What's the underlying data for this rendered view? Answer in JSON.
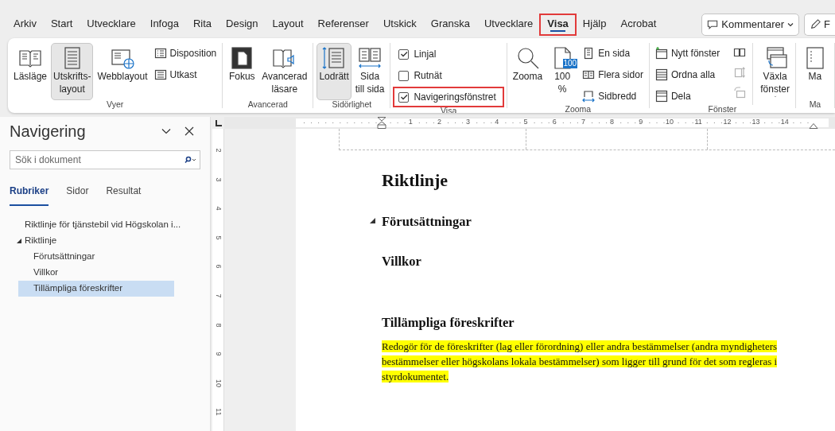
{
  "menu_tabs": [
    {
      "label": "Arkiv",
      "selected": false,
      "highlighted": false
    },
    {
      "label": "Start",
      "selected": false,
      "highlighted": false
    },
    {
      "label": "Utvecklare",
      "selected": false,
      "highlighted": false
    },
    {
      "label": "Infoga",
      "selected": false,
      "highlighted": false
    },
    {
      "label": "Rita",
      "selected": false,
      "highlighted": false
    },
    {
      "label": "Design",
      "selected": false,
      "highlighted": false
    },
    {
      "label": "Layout",
      "selected": false,
      "highlighted": false
    },
    {
      "label": "Referenser",
      "selected": false,
      "highlighted": false
    },
    {
      "label": "Utskick",
      "selected": false,
      "highlighted": false
    },
    {
      "label": "Granska",
      "selected": false,
      "highlighted": false
    },
    {
      "label": "Utvecklare",
      "selected": false,
      "highlighted": false
    },
    {
      "label": "Visa",
      "selected": true,
      "highlighted": true
    },
    {
      "label": "Hjälp",
      "selected": false,
      "highlighted": false
    },
    {
      "label": "Acrobat",
      "selected": false,
      "highlighted": false
    }
  ],
  "top_buttons": [
    {
      "label": "Kommentarer",
      "dropdown": true
    },
    {
      "label": "F",
      "dropdown": false
    }
  ],
  "ribbon": {
    "groups": [
      {
        "label": "Vyer",
        "columns": [
          {
            "kind": "large",
            "label": "Läsläge",
            "selected": false
          },
          {
            "kind": "large",
            "label": "Utskrifts-\nlayout",
            "selected": true
          },
          {
            "kind": "large",
            "label": "Webblayout",
            "selected": false
          },
          {
            "kind": "smalls",
            "items": [
              {
                "label": "Disposition"
              },
              {
                "label": "Utkast"
              }
            ]
          }
        ]
      },
      {
        "label": "Avancerad",
        "columns": [
          {
            "kind": "large",
            "label": "Fokus",
            "selected": false
          },
          {
            "kind": "large",
            "label": "Avancerad\nläsare",
            "selected": false
          }
        ]
      },
      {
        "label": "Sidörlighet",
        "columns": [
          {
            "kind": "large",
            "label": "Lodrätt",
            "selected": true
          },
          {
            "kind": "large",
            "label": "Sida\ntill sida",
            "selected": false
          }
        ]
      },
      {
        "label": "Visa",
        "columns": [
          {
            "kind": "checks",
            "items": [
              {
                "label": "Linjal",
                "checked": true,
                "highlighted": false
              },
              {
                "label": "Rutnät",
                "checked": false,
                "highlighted": false
              },
              {
                "label": "Navigeringsfönstret",
                "checked": true,
                "highlighted": true
              }
            ]
          }
        ]
      },
      {
        "label": "Zooma",
        "columns": [
          {
            "kind": "large",
            "label": "Zooma",
            "selected": false
          },
          {
            "kind": "large",
            "badge": "100",
            "label": "100\n%",
            "selected": false
          },
          {
            "kind": "smalls",
            "items": [
              {
                "label": "En sida"
              },
              {
                "label": "Flera sidor"
              },
              {
                "label": "Sidbredd"
              }
            ]
          }
        ]
      },
      {
        "label": "Fönster",
        "columns": [
          {
            "kind": "smalls",
            "items": [
              {
                "label": "Nytt fönster"
              },
              {
                "label": "Ordna alla"
              },
              {
                "label": "Dela"
              }
            ]
          },
          {
            "kind": "icons",
            "items": [
              {
                "disabled": false
              },
              {
                "disabled": true
              },
              {
                "disabled": true
              }
            ]
          },
          {
            "kind": "large",
            "label": "Växla\nfönster",
            "dropdown": true,
            "selected": false
          }
        ]
      },
      {
        "label": "Ma",
        "columns": [
          {
            "kind": "large",
            "label": "Ma",
            "selected": false
          }
        ]
      }
    ]
  },
  "navigation": {
    "title": "Navigering",
    "search": {
      "placeholder": "Sök i dokument"
    },
    "tabs": [
      {
        "label": "Rubriker",
        "selected": true
      },
      {
        "label": "Sidor",
        "selected": false
      },
      {
        "label": "Resultat",
        "selected": false
      }
    ],
    "tree": [
      {
        "label": "Riktlinje för tjänstebil vid Högskolan i...",
        "selected": false
      },
      {
        "label": "Riktlinje",
        "selected": false,
        "expanded": true,
        "children": [
          {
            "label": "Förutsättningar",
            "selected": false
          },
          {
            "label": "Villkor",
            "selected": false
          },
          {
            "label": "Tillämpliga föreskrifter",
            "selected": true
          }
        ]
      }
    ]
  },
  "rulers": {
    "horizontal": [
      "1",
      "2",
      "3",
      "4",
      "5",
      "6",
      "7",
      "8",
      "9",
      "10",
      "11",
      "12",
      "13",
      "14"
    ],
    "vertical": [
      "2",
      "3",
      "4",
      "5",
      "6",
      "7",
      "8",
      "9",
      "10",
      "11"
    ]
  },
  "document": {
    "blocks": [
      {
        "kind": "title",
        "text": "Riktlinje"
      },
      {
        "kind": "heading",
        "text": "Förutsättningar",
        "collapse_marker": true
      },
      {
        "kind": "heading",
        "text": "Villkor",
        "collapse_marker": false
      },
      {
        "kind": "heading",
        "text": "Tillämpliga föreskrifter",
        "collapse_marker": false
      },
      {
        "kind": "paragraph",
        "text": "Redogör för de föreskrifter (lag eller förordning) eller andra bestämmelser (andra myndigheters bestämmelser eller högskolans lokala bestämmelser) som ligger till grund för det som regleras i styrdokumentet.",
        "highlighted": true
      }
    ]
  }
}
